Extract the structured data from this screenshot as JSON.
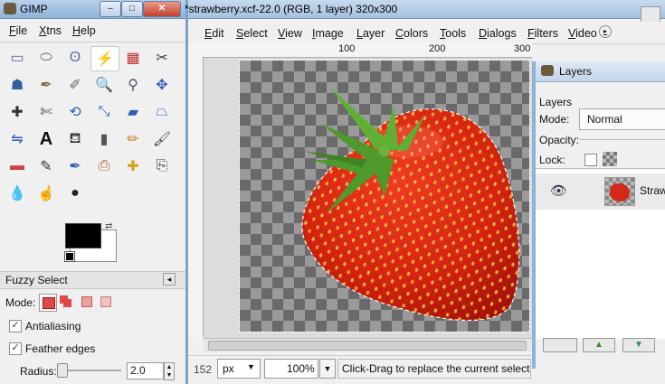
{
  "toolbox": {
    "title": "GIMP",
    "menu": [
      "File",
      "Xtns",
      "Help"
    ],
    "tool_icons": [
      "rect-select-icon",
      "ellipse-select-icon",
      "free-select-icon",
      "fuzzy-select-icon",
      "color-select-icon",
      "scissors-icon",
      "foreground-select-icon",
      "paths-icon",
      "color-picker-icon",
      "zoom-icon",
      "measure-icon",
      "move-icon",
      "align-icon",
      "crop-icon",
      "rotate-icon",
      "scale-icon",
      "shear-icon",
      "perspective-icon",
      "flip-icon",
      "text-icon",
      "bucket-fill-icon",
      "blend-icon",
      "pencil-icon",
      "paintbrush-icon",
      "eraser-icon",
      "airbrush-icon",
      "ink-icon",
      "clone-icon",
      "heal-icon",
      "perspective-clone-icon",
      "blur-icon",
      "smudge-icon",
      "dodge-burn-icon"
    ],
    "active_tool": "fuzzy-select-icon",
    "colors": {
      "foreground": "#000000",
      "background": "#ffffff"
    },
    "options": {
      "title": "Fuzzy Select",
      "mode_label": "Mode:",
      "antialiasing_label": "Antialiasing",
      "antialiasing_checked": true,
      "feather_label": "Feather edges",
      "feather_checked": true,
      "radius_label": "Radius:",
      "radius_value": "2.0"
    }
  },
  "image_window": {
    "title": "*strawberry.xcf-22.0 (RGB, 1 layer) 320x300",
    "menu": [
      "Edit",
      "Select",
      "View",
      "Image",
      "Layer",
      "Colors",
      "Tools",
      "Dialogs",
      "Filters",
      "Video"
    ],
    "ruler_marks": [
      "100",
      "200",
      "300"
    ],
    "status": {
      "coord": "152",
      "unit": "px",
      "zoom": "100%",
      "message": "Click-Drag to replace the current selection (try Shift"
    }
  },
  "layers_dock": {
    "title": "Layers",
    "tab": "Layers",
    "mode_label": "Mode:",
    "mode_value": "Normal",
    "opacity_label": "Opacity:",
    "lock_label": "Lock:",
    "layer_name": "Straw"
  },
  "colors": {
    "accent": "#7ea3c7",
    "selection": "#ffffff",
    "strawberry": "#d8281a"
  }
}
